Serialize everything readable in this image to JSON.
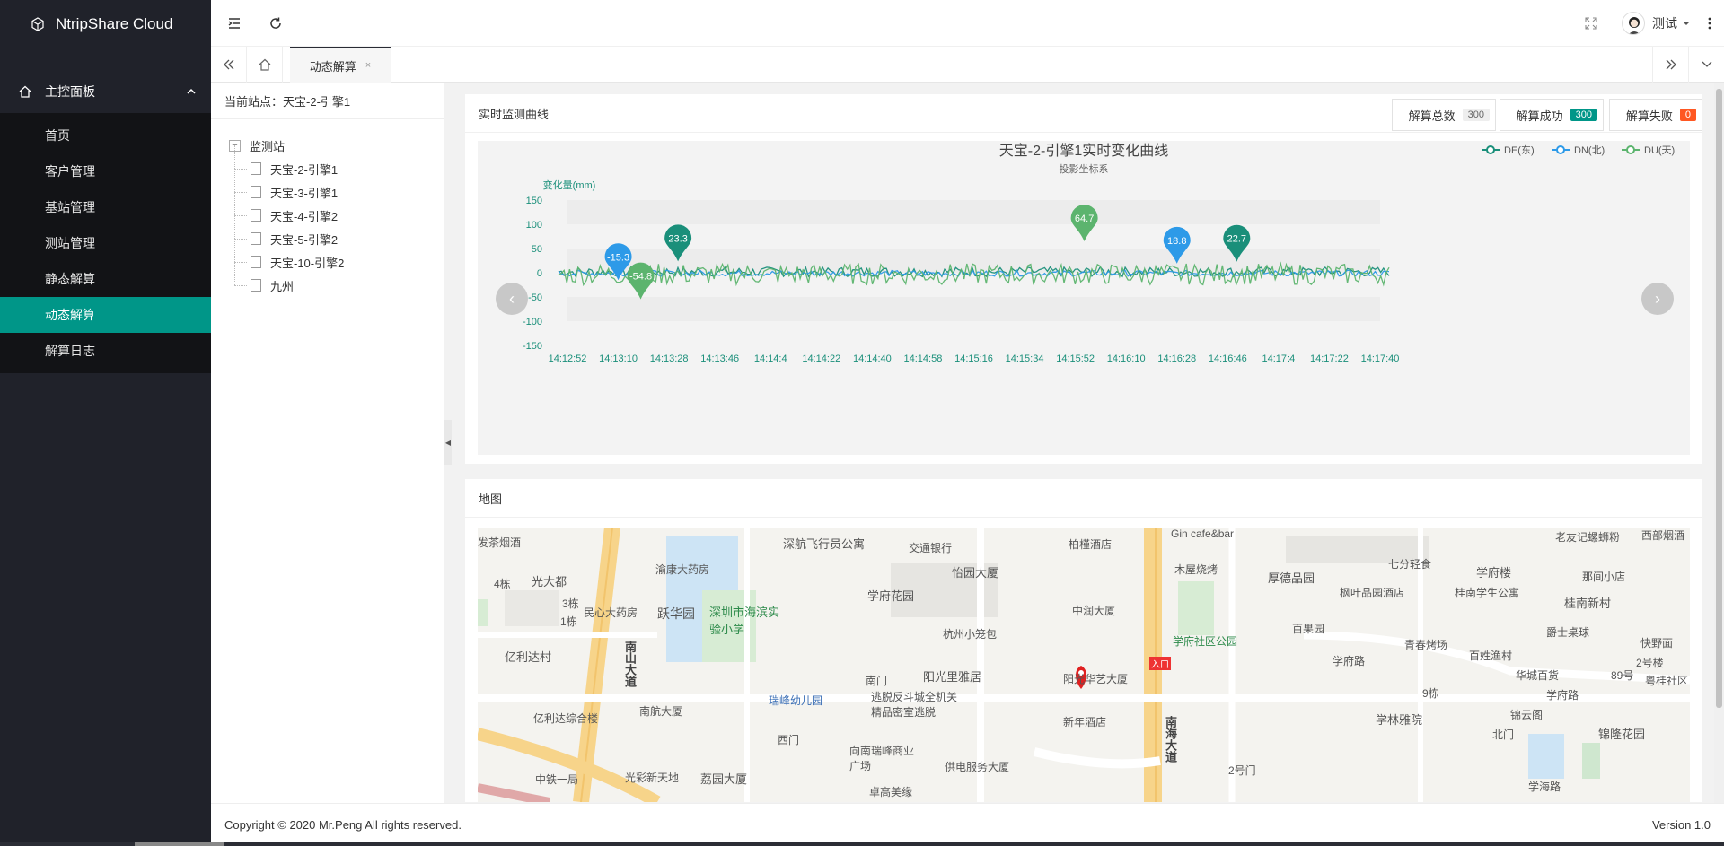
{
  "app": {
    "title": "NtripShare Cloud"
  },
  "sidebar": {
    "group_label": "主控面板",
    "items": [
      {
        "label": "首页"
      },
      {
        "label": "客户管理"
      },
      {
        "label": "基站管理"
      },
      {
        "label": "测站管理"
      },
      {
        "label": "静态解算"
      },
      {
        "label": "动态解算",
        "active": true
      },
      {
        "label": "解算日志"
      }
    ]
  },
  "header": {
    "user_name": "测试"
  },
  "tabs": [
    {
      "label": "动态解算",
      "close": "×"
    }
  ],
  "tree": {
    "current_prefix": "当前站点：",
    "current_value": "天宝-2-引擎1",
    "root": "监测站",
    "children": [
      "天宝-2-引擎1",
      "天宝-3-引擎1",
      "天宝-4-引擎2",
      "天宝-5-引擎2",
      "天宝-10-引擎2",
      "九州"
    ]
  },
  "monitor": {
    "title": "实时监测曲线",
    "stats": [
      {
        "label": "解算总数",
        "value": "300",
        "color": "#eeeeee"
      },
      {
        "label": "解算成功",
        "value": "300",
        "color": "#009688"
      },
      {
        "label": "解算失败",
        "value": "0",
        "color": "#ff5722"
      }
    ]
  },
  "chart_data": {
    "type": "line",
    "title": "天宝-2-引擎1实时变化曲线",
    "subtitle": "投影坐标系",
    "ylabel": "变化量(mm)",
    "ylim": [
      -150,
      150
    ],
    "yticks": [
      150,
      100,
      50,
      0,
      -50,
      -100,
      -150
    ],
    "x_ticks": [
      "14:12:52",
      "14:13:10",
      "14:13:28",
      "14:13:46",
      "14:14:4",
      "14:14:22",
      "14:14:40",
      "14:14:58",
      "14:15:16",
      "14:15:34",
      "14:15:52",
      "14:16:10",
      "14:16:28",
      "14:16:46",
      "14:17:4",
      "14:17:22",
      "14:17:40"
    ],
    "legend_position": "top-right",
    "series": [
      {
        "name": "DE(东)",
        "color": "#1a8f7a"
      },
      {
        "name": "DN(北)",
        "color": "#2d9ae8"
      },
      {
        "name": "DU(天)",
        "color": "#5cb46e"
      }
    ],
    "markers": [
      {
        "label": "-15.3",
        "value": -15.3,
        "series": "DN(北)",
        "x": "14:13:10"
      },
      {
        "label": "-54.8",
        "value": -54.8,
        "series": "DU(天)",
        "x": "14:13:10"
      },
      {
        "label": "23.3",
        "value": 23.3,
        "series": "DE(东)",
        "x": "14:13:28"
      },
      {
        "label": "64.7",
        "value": 64.7,
        "series": "DU(天)",
        "x": "14:15:52"
      },
      {
        "label": "18.8",
        "value": 18.8,
        "series": "DN(北)",
        "x": "14:16:28"
      },
      {
        "label": "22.7",
        "value": 22.7,
        "series": "DE(东)",
        "x": "14:16:46"
      }
    ]
  },
  "map": {
    "title": "地图",
    "labels": [
      "发茶烟酒",
      "渝康大药房",
      "深航飞行员公寓",
      "交通银行",
      "柏槿酒店",
      "Gin cafe&bar",
      "老友记螺蛳粉",
      "西部烟酒",
      "光大都",
      "4栋",
      "深圳市海滨实验小学",
      "怡园大厦",
      "木屋烧烤",
      "厚德品园",
      "七分轻食",
      "学府楼",
      "那间小店",
      "民心大药房",
      "跃华园",
      "学府花园",
      "中润大厦",
      "枫叶品园酒店",
      "桂南学生公寓",
      "桂南新村",
      "3栋",
      "1栋",
      "杭州小笼包",
      "百果园",
      "学府社区公园",
      "青春烤场",
      "爵士桌球",
      "快野面",
      "亿利达村",
      "南山大道",
      "南门",
      "阳光里雅居",
      "学府路",
      "百姓渔村",
      "2号楼",
      "华城百货",
      "89号",
      "粤桂社区",
      "瑞峰幼儿园",
      "逃脱反斗城全机关精品密室逃脱",
      "阳光华艺大厦",
      "9栋",
      "学府路",
      "亿利达综合楼",
      "南航大厦",
      "新年酒店",
      "南海大道",
      "学林雅院",
      "锦云阁",
      "北门",
      "锦隆花园",
      "西门",
      "向南瑞峰商业广场",
      "供电服务大厦",
      "光彩新天地",
      "荔园大厦",
      "卓高美缘",
      "中铁一局",
      "学海路",
      "2号门",
      "入口"
    ]
  },
  "footer": {
    "copyright": "Copyright © 2020 Mr.Peng All rights reserved.",
    "version": "Version 1.0"
  }
}
